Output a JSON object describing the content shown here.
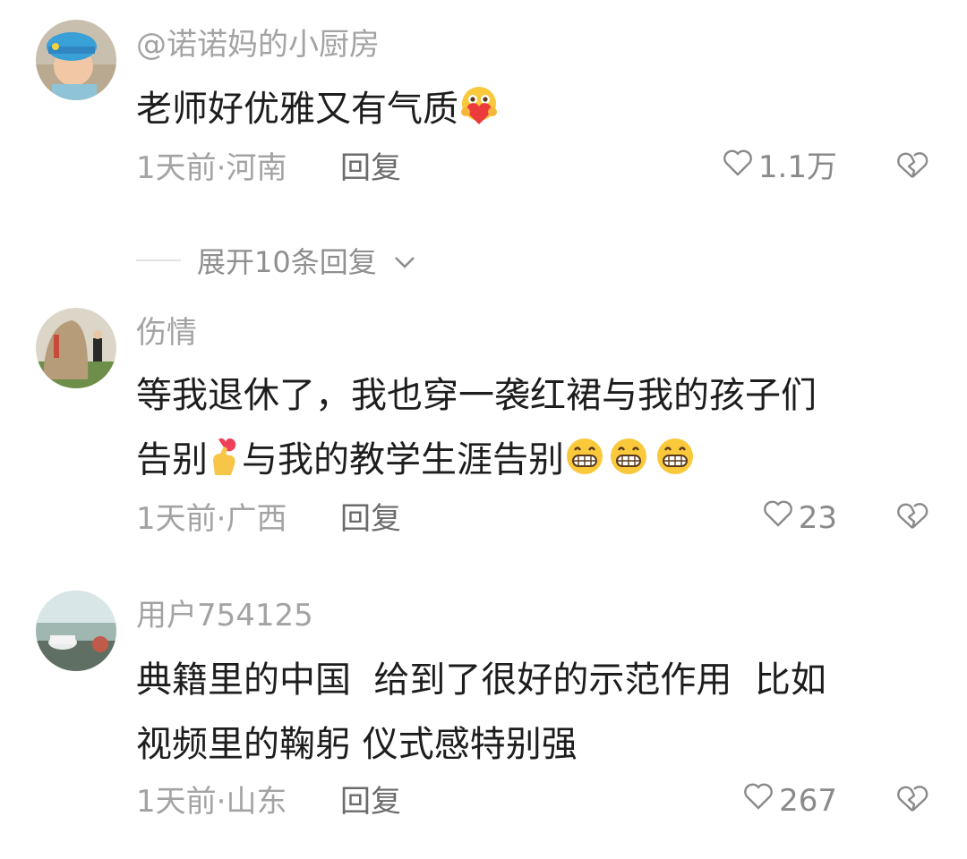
{
  "comments": [
    {
      "username": "@诺诺妈的小厨房",
      "text": "老师好优雅又有气质",
      "time_location": "1天前·河南",
      "reply_label": "回复",
      "likes": "1.1万"
    },
    {
      "username": "伤情",
      "text_line1": "等我退休了，我也穿一袭红裙与我的孩子们",
      "text_line2a": "告别",
      "text_line2b": "与我的教学生涯告别",
      "time_location": "1天前·广西",
      "reply_label": "回复",
      "likes": "23"
    },
    {
      "username": "用户754125",
      "text_line1": "典籍里的中国  给到了很好的示范作用  比如",
      "text_line2": "视频里的鞠躬 仪式感特别强",
      "time_location": "1天前·山东",
      "reply_label": "回复",
      "likes": "267"
    }
  ],
  "expand_replies_label": "展开10条回复",
  "colors": {
    "text": "#1d1d1d",
    "secondary": "#a3a3a3",
    "reply": "#6b6b6b"
  }
}
